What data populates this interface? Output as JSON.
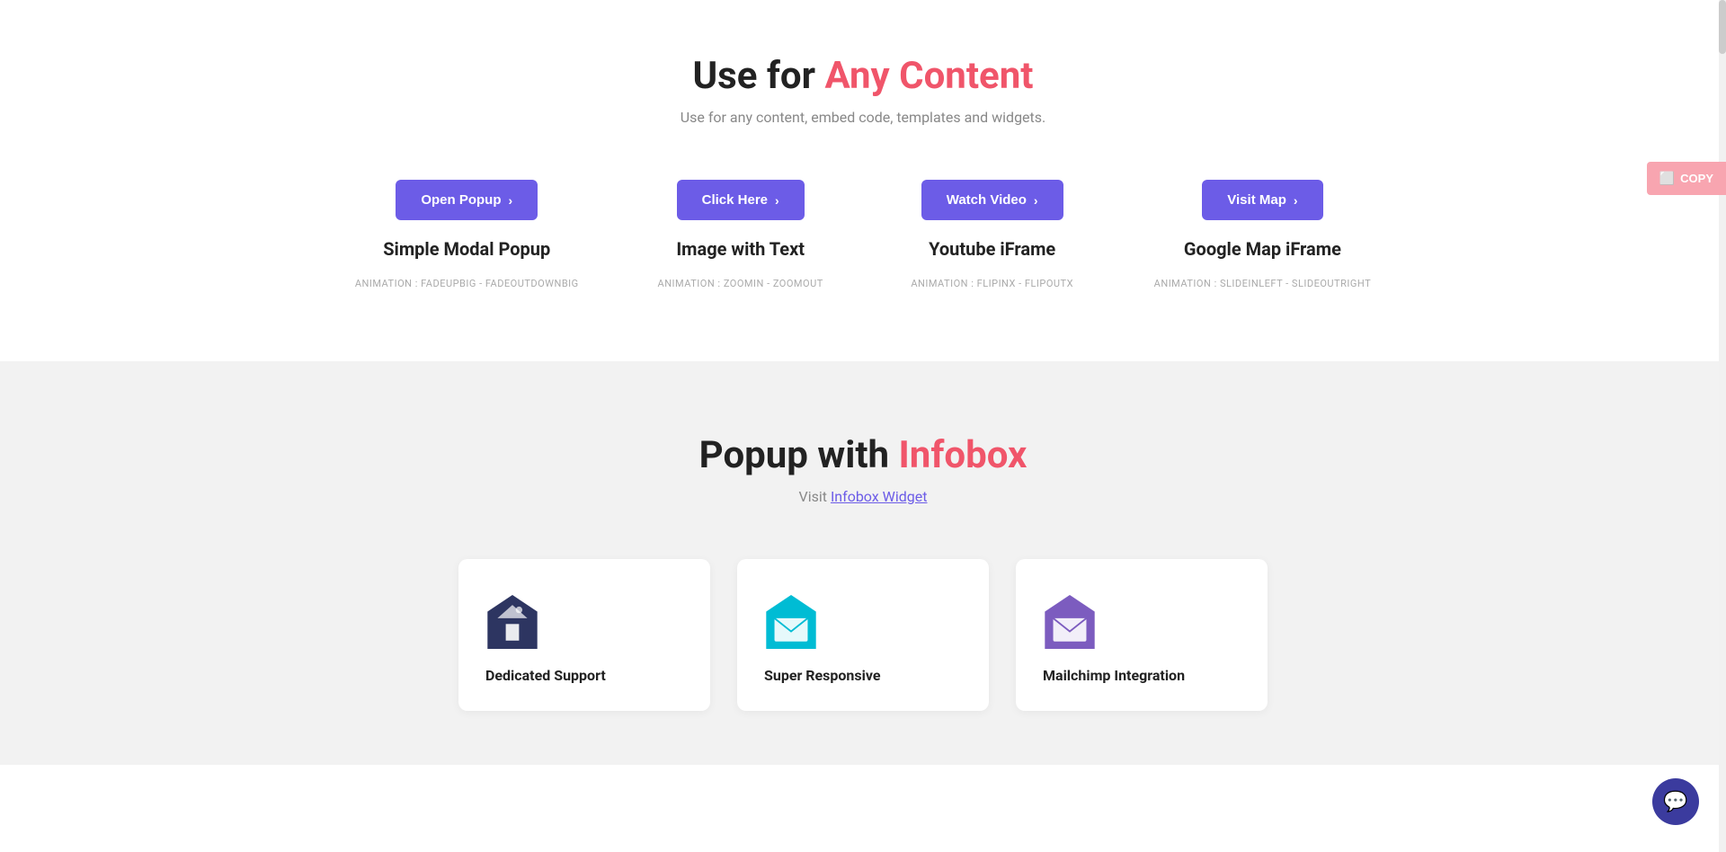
{
  "page": {
    "section1": {
      "heading_normal": "Use for ",
      "heading_highlight": "Any Content",
      "subheading": "Use for any content, embed code, templates and widgets.",
      "cards": [
        {
          "button_label": "Open Popup",
          "title": "Simple Modal Popup",
          "animation": "ANIMATION : FADEUPBIG - FADEOUTDOWNBIG"
        },
        {
          "button_label": "Click Here",
          "title": "Image with Text",
          "animation": "ANIMATION : ZOOMIN - ZOOMOUT"
        },
        {
          "button_label": "Watch Video",
          "title": "Youtube iFrame",
          "animation": "ANIMATION : FLIPINX - FLIPOUTX"
        },
        {
          "button_label": "Visit Map",
          "title": "Google Map iFrame",
          "animation": "ANIMATION : SLIDEINLEFT - SLIDEOUTRIGHT"
        }
      ]
    },
    "section2": {
      "heading_normal": "Popup with ",
      "heading_highlight": "Infobox",
      "subheading_prefix": "Visit ",
      "subheading_link": "Infobox Widget",
      "cards": [
        {
          "icon_color": "#2d3561",
          "title": "Dedicated Support",
          "icon_type": "house"
        },
        {
          "icon_color": "#00bcd4",
          "title": "Super Responsive",
          "icon_type": "envelope"
        },
        {
          "icon_color": "#7c5cbf",
          "title": "Mailchimp Integration",
          "icon_type": "envelope-purple"
        }
      ]
    },
    "copy_button": {
      "label": "COPY",
      "icon": "copy"
    },
    "colors": {
      "accent_purple": "#6c5ce7",
      "accent_pink": "#f0556a",
      "copy_btn_bg": "#f8a5b0",
      "chat_bg": "#3b3b9e"
    }
  }
}
